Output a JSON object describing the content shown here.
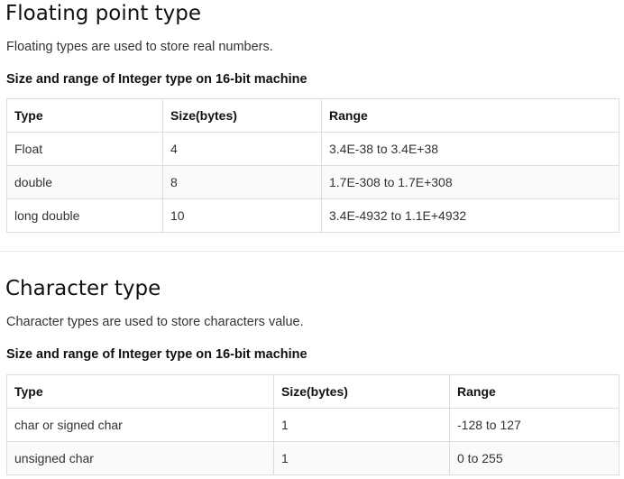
{
  "floating": {
    "title": "Floating point type",
    "description": "Floating types are used to store real numbers.",
    "caption": "Size and range of Integer type on 16-bit machine",
    "headers": [
      "Type",
      "Size(bytes)",
      "Range"
    ],
    "rows": [
      [
        "Float",
        "4",
        "3.4E-38 to 3.4E+38"
      ],
      [
        "double",
        "8",
        "1.7E-308 to 1.7E+308"
      ],
      [
        "long double",
        "10",
        "3.4E-4932 to 1.1E+4932"
      ]
    ]
  },
  "character": {
    "title": "Character type",
    "description": "Character types are used to store characters value.",
    "caption": "Size and range of Integer type on 16-bit machine",
    "headers": [
      "Type",
      "Size(bytes)",
      "Range"
    ],
    "rows": [
      [
        "char or signed char",
        "1",
        "-128 to 127"
      ],
      [
        "unsigned char",
        "1",
        "0 to 255"
      ]
    ]
  }
}
